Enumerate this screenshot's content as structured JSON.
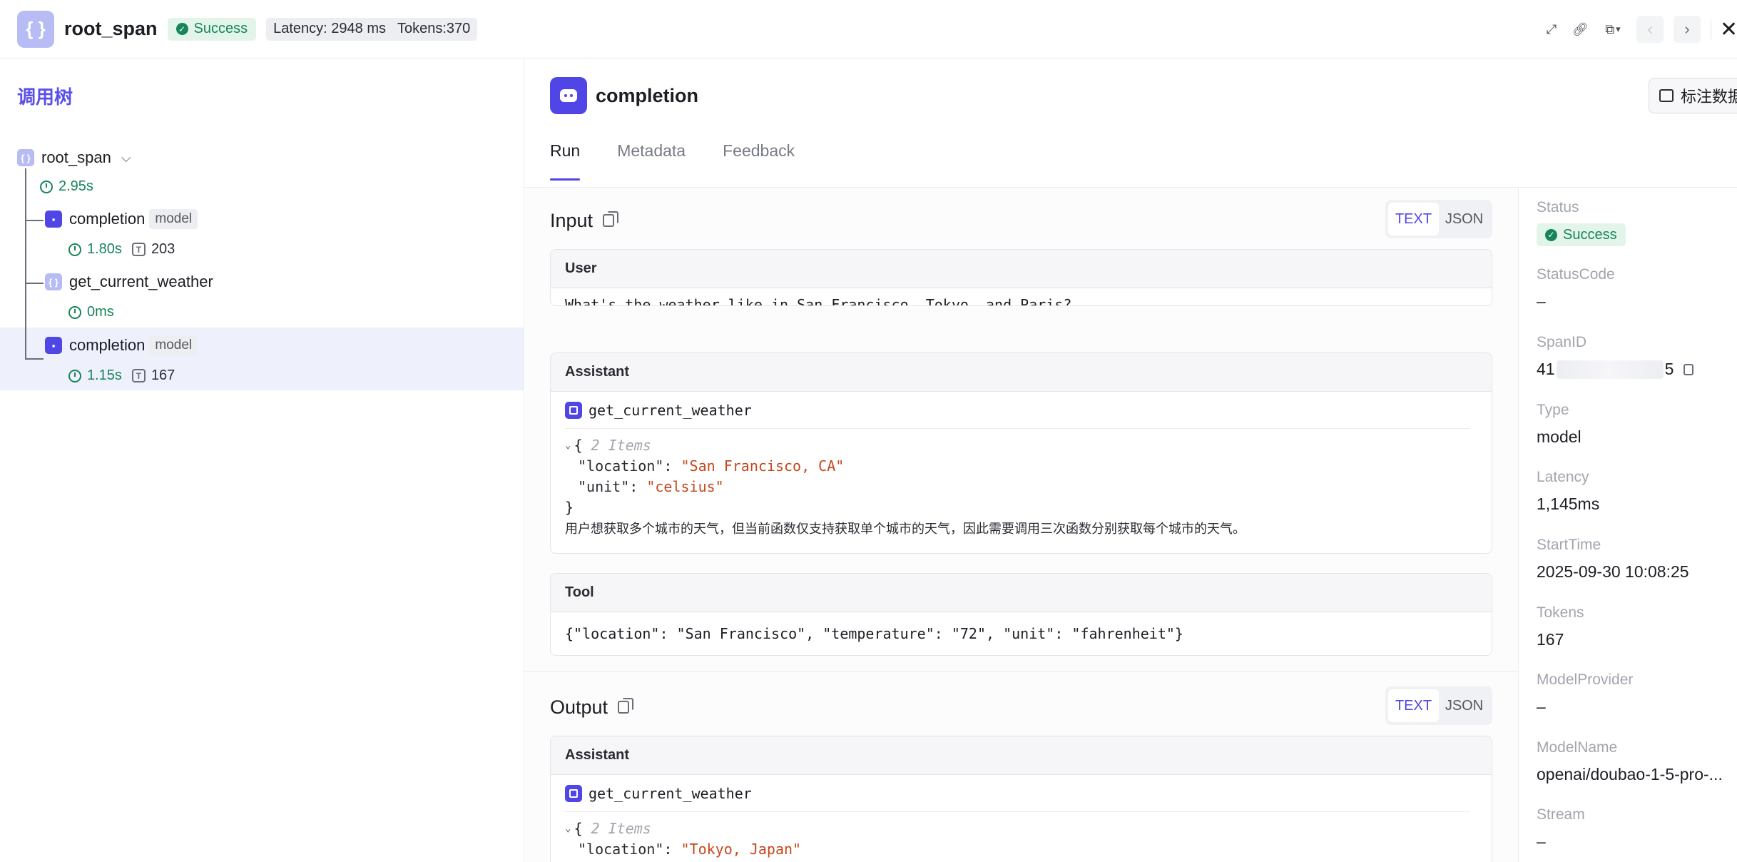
{
  "header": {
    "root_icon": "{ }",
    "title": "root_span",
    "status": "Success",
    "latency": "Latency: 2948 ms",
    "tokens": "Tokens:370",
    "icons": [
      "expand-icon",
      "link-icon",
      "copy-dropdown-icon",
      "prev-icon",
      "next-icon",
      "close-icon"
    ]
  },
  "tree": {
    "title": "调用树",
    "root": {
      "icon": "{ }",
      "label": "root_span",
      "time": "2.95s"
    },
    "nodes": [
      {
        "icon": "model",
        "label": "completion",
        "tag": "model",
        "time": "1.80s",
        "tokens": "203"
      },
      {
        "icon": "{ }",
        "label": "get_current_weather",
        "time": "0ms"
      },
      {
        "icon": "model",
        "label": "completion",
        "tag": "model",
        "time": "1.15s",
        "tokens": "167",
        "selected": true
      }
    ],
    "token_icon": "T"
  },
  "span": {
    "title": "completion",
    "annotate_label": "标注数据",
    "tabs": [
      "Run",
      "Metadata",
      "Feedback"
    ]
  },
  "input": {
    "title": "Input",
    "formats": [
      "TEXT",
      "JSON"
    ],
    "messages": {
      "user": {
        "role": "User",
        "text": "What's the weather like in San Francisco, Tokyo, and Paris?"
      },
      "assistant": {
        "role": "Assistant",
        "tool_name": "get_current_weather",
        "items_meta": "2 Items",
        "args": [
          {
            "key": "\"location\"",
            "value": "\"San Francisco, CA\""
          },
          {
            "key": "\"unit\"",
            "value": "\"celsius\""
          }
        ],
        "note": "用户想获取多个城市的天气，但当前函数仅支持获取单个城市的天气，因此需要调用三次函数分别获取每个城市的天气。"
      },
      "tool": {
        "role": "Tool",
        "text": "{\"location\": \"San Francisco\", \"temperature\": \"72\", \"unit\": \"fahrenheit\"}"
      }
    }
  },
  "output": {
    "title": "Output",
    "formats": [
      "TEXT",
      "JSON"
    ],
    "assistant": {
      "role": "Assistant",
      "tool_name": "get_current_weather",
      "items_meta": "2 Items",
      "args": [
        {
          "key": "\"location\"",
          "value": "\"Tokyo, Japan\""
        }
      ]
    }
  },
  "details": {
    "status": {
      "label": "Status",
      "value": "Success"
    },
    "status_code": {
      "label": "StatusCode",
      "value": "–"
    },
    "span_id": {
      "label": "SpanID",
      "prefix": "41",
      "suffix": "5"
    },
    "type": {
      "label": "Type",
      "value": "model"
    },
    "latency": {
      "label": "Latency",
      "value": "1,145ms"
    },
    "start_time": {
      "label": "StartTime",
      "value": "2025-09-30 10:08:25"
    },
    "tokens": {
      "label": "Tokens",
      "value": "167"
    },
    "model_provider": {
      "label": "ModelProvider",
      "value": "–"
    },
    "model_name": {
      "label": "ModelName",
      "value": "openai/doubao-1-5-pro-..."
    },
    "stream": {
      "label": "Stream",
      "value": "–"
    }
  },
  "colors": {
    "accent": "#5046e5",
    "success": "#16855a",
    "string": "#c5471d",
    "selected_row": "#eef0fc"
  }
}
